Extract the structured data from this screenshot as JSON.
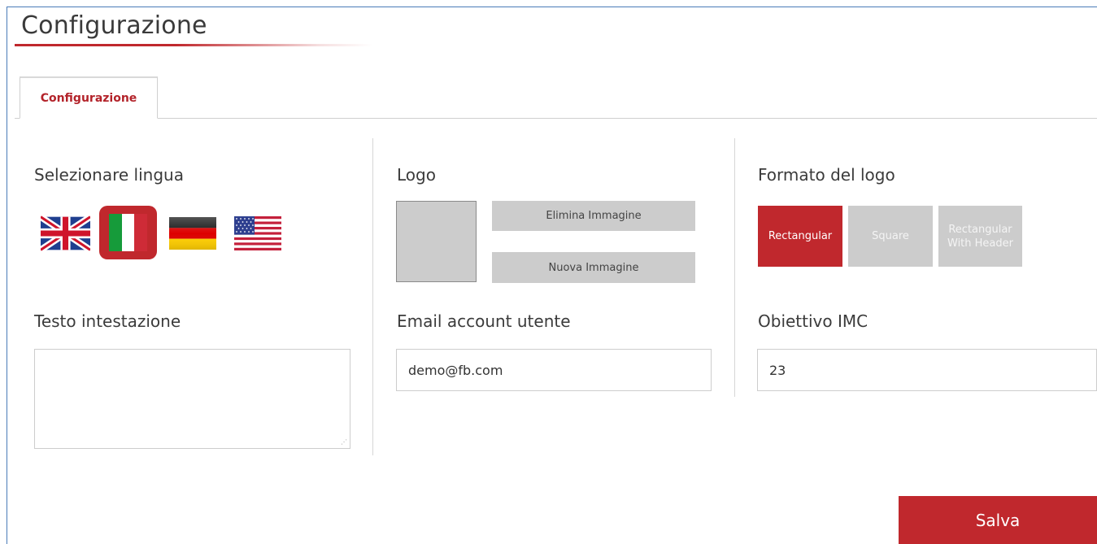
{
  "page": {
    "title": "Configurazione"
  },
  "tabs": [
    {
      "label": "Configurazione",
      "active": true
    }
  ],
  "language": {
    "label": "Selezionare lingua",
    "flags": [
      {
        "icon": "uk-flag-icon",
        "selected": false
      },
      {
        "icon": "italy-flag-icon",
        "selected": true
      },
      {
        "icon": "germany-flag-icon",
        "selected": false
      },
      {
        "icon": "usa-flag-icon",
        "selected": false
      }
    ]
  },
  "logo": {
    "label": "Logo",
    "delete_label": "Elimina Immagine",
    "new_label": "Nuova Immagine"
  },
  "logo_format": {
    "label": "Formato del logo",
    "options": [
      {
        "label": "Rectangular",
        "active": true
      },
      {
        "label": "Square",
        "active": false
      },
      {
        "label": "Rectangular With Header",
        "active": false
      }
    ]
  },
  "header_text": {
    "label": "Testo intestazione",
    "value": ""
  },
  "email": {
    "label": "Email account utente",
    "value": "demo@fb.com"
  },
  "bmi_target": {
    "label": "Obiettivo IMC",
    "value": "23"
  },
  "actions": {
    "save_label": "Salva"
  },
  "colors": {
    "accent": "#c0282d",
    "inactive": "#cccccc",
    "frame": "#4a7bb8"
  }
}
